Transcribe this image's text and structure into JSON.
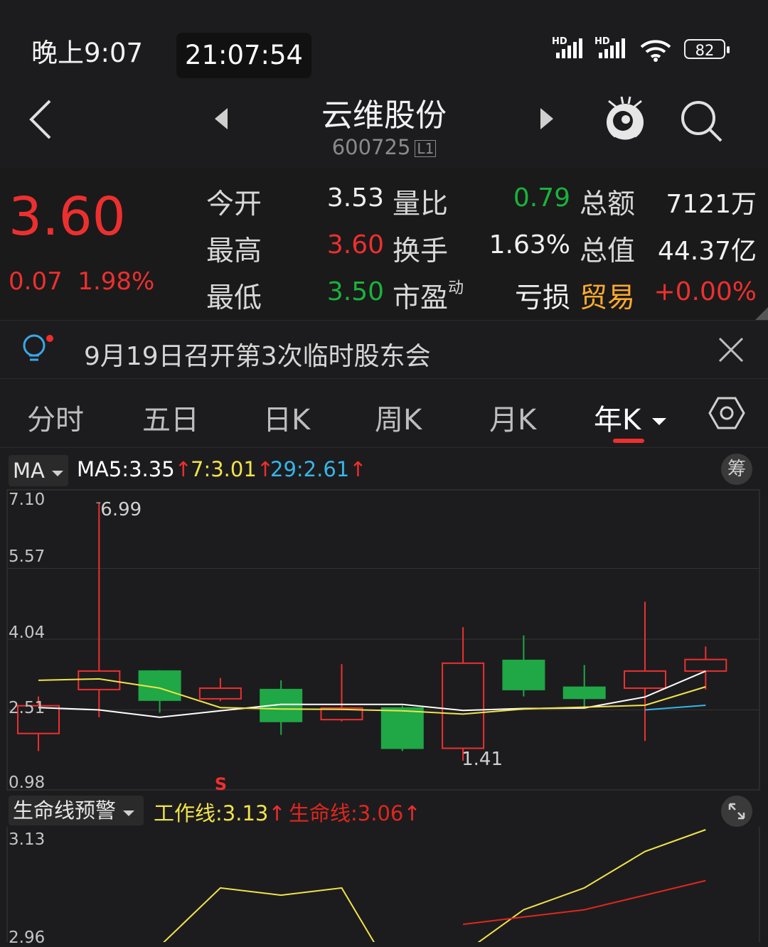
{
  "status_bar": {
    "time": "晚上9:07",
    "clock": "21:07:54",
    "battery": "82",
    "hd1": "HD",
    "hd2": "HD"
  },
  "header": {
    "stock_name": "云维股份",
    "stock_code": "600725",
    "level_badge": "L1",
    "back_icon": "chevron-left-icon",
    "prev_icon": "triangle-left-icon",
    "next_icon": "triangle-right-icon",
    "mascot_icon": "mascot-icon",
    "search_icon": "search-icon"
  },
  "quote": {
    "price": "3.60",
    "change": "0.07",
    "change_pct": "1.98%",
    "rows": [
      [
        {
          "label": "今开",
          "value": "3.53",
          "color": "white"
        },
        {
          "label": "量比",
          "value": "0.79",
          "color": "green"
        },
        {
          "label": "总额",
          "value": "7121万",
          "color": "white"
        }
      ],
      [
        {
          "label": "最高",
          "value": "3.60",
          "color": "red"
        },
        {
          "label": "换手",
          "value": "1.63%",
          "color": "white"
        },
        {
          "label": "总值",
          "value": "44.37亿",
          "color": "white"
        }
      ],
      [
        {
          "label": "最低",
          "value": "3.50",
          "color": "green"
        },
        {
          "label": "市盈",
          "sup": "动",
          "value": "亏损",
          "color": "white"
        },
        {
          "label": "贸易",
          "value": "+0.00%",
          "color": "red"
        }
      ]
    ]
  },
  "notice": {
    "text": "9月19日召开第3次临时股东会",
    "icon": "lightbulb-icon",
    "close_icon": "close-icon"
  },
  "tabs": {
    "items": [
      "分时",
      "五日",
      "日K",
      "周K",
      "月K",
      "年K"
    ],
    "active_index": 5,
    "settings_icon": "hexagon-settings-icon"
  },
  "ma_bar": {
    "dropdown_label": "MA",
    "ma5_label": "MA5:",
    "ma5_value": "3.35",
    "ma7_label": "7:",
    "ma7_value": "3.01",
    "ma29_label": "29:",
    "ma29_value": "2.61",
    "chips_label": "筹"
  },
  "chart_data": [
    {
      "type": "candlestick",
      "y_ticks": [
        "7.10",
        "5.57",
        "4.04",
        "2.51",
        "0.98"
      ],
      "ylim": [
        0.98,
        7.1
      ],
      "annotations": [
        {
          "text": "6.99",
          "role": "max"
        },
        {
          "text": "1.41",
          "role": "min"
        },
        {
          "text": "S",
          "role": "sell-marker"
        }
      ],
      "candles": [
        {
          "open": 2.0,
          "close": 2.6,
          "high": 2.8,
          "low": 1.62
        },
        {
          "open": 2.95,
          "close": 3.35,
          "high": 6.99,
          "low": 2.35
        },
        {
          "open": 3.35,
          "close": 2.72,
          "high": 3.37,
          "low": 2.45
        },
        {
          "open": 2.75,
          "close": 2.98,
          "high": 3.2,
          "low": 2.7
        },
        {
          "open": 2.95,
          "close": 2.26,
          "high": 3.15,
          "low": 1.97
        },
        {
          "open": 2.3,
          "close": 2.55,
          "high": 3.5,
          "low": 2.26
        },
        {
          "open": 2.55,
          "close": 1.68,
          "high": 2.6,
          "low": 1.62
        },
        {
          "open": 1.68,
          "close": 3.52,
          "high": 4.3,
          "low": 1.41
        },
        {
          "open": 3.58,
          "close": 2.95,
          "high": 4.12,
          "low": 2.8
        },
        {
          "open": 3.0,
          "close": 2.76,
          "high": 3.48,
          "low": 2.55
        },
        {
          "open": 2.98,
          "close": 3.35,
          "high": 4.85,
          "low": 1.84
        },
        {
          "open": 3.35,
          "close": 3.6,
          "high": 3.88,
          "low": 2.95
        }
      ],
      "series": [
        {
          "name": "MA5",
          "color": "#ffffff",
          "values": [
            2.56,
            2.51,
            2.35,
            2.49,
            2.63,
            2.63,
            2.63,
            2.5,
            2.54,
            2.55,
            2.79,
            3.35
          ]
        },
        {
          "name": "7",
          "color": "#f2e34a",
          "values": [
            3.15,
            3.18,
            2.98,
            2.56,
            2.53,
            2.52,
            2.49,
            2.42,
            2.53,
            2.57,
            2.61,
            3.01
          ]
        },
        {
          "name": "29",
          "color": "#37b5e8",
          "values": [
            null,
            null,
            null,
            null,
            null,
            null,
            null,
            null,
            null,
            null,
            2.51,
            2.61
          ]
        }
      ]
    },
    {
      "type": "line",
      "y_ticks": [
        "3.13",
        "2.96"
      ],
      "ylim": [
        2.96,
        3.13
      ],
      "series": [
        {
          "name": "工作线",
          "color": "#f2e34a",
          "values": [
            null,
            null,
            2.97,
            3.05,
            3.04,
            3.05,
            2.91,
            2.96,
            3.02,
            3.05,
            3.1,
            3.13
          ]
        },
        {
          "name": "生命线",
          "color": "#e0261e",
          "values": [
            null,
            null,
            null,
            null,
            null,
            null,
            null,
            3.0,
            3.01,
            3.02,
            3.04,
            3.06
          ]
        }
      ]
    }
  ],
  "life_bar": {
    "dropdown_label": "生命线预警",
    "work_label": "工作线:",
    "work_value": "3.13",
    "life_label": "生命线:",
    "life_value": "3.06",
    "expand_icon": "expand-icon"
  }
}
